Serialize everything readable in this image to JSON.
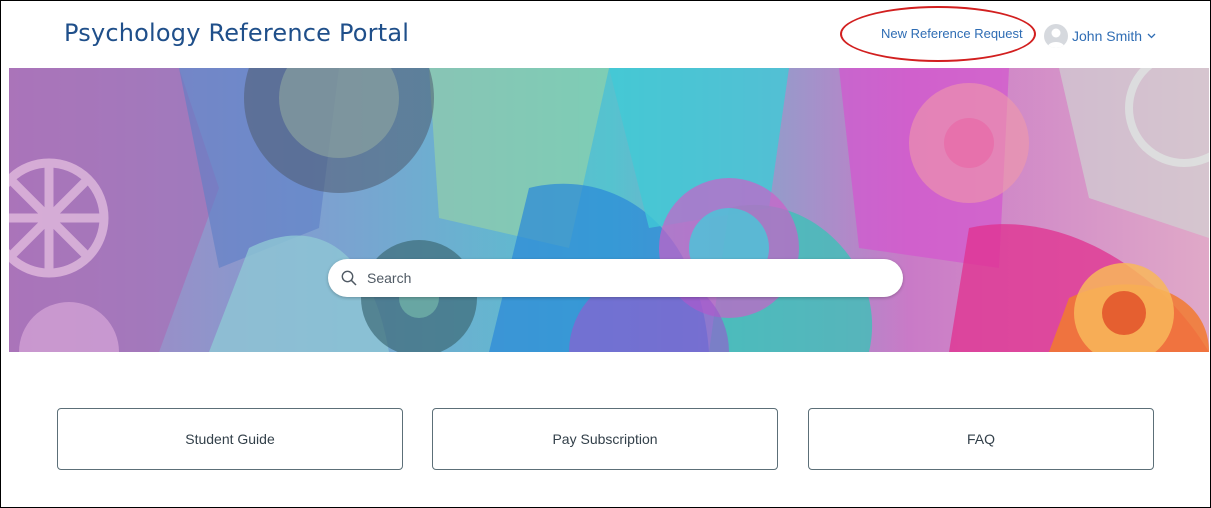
{
  "header": {
    "title": "Psychology Reference Portal",
    "nav_link": "New Reference Request",
    "user_name": "John Smith"
  },
  "search": {
    "placeholder": "Search"
  },
  "tiles": [
    {
      "label": "Student Guide"
    },
    {
      "label": "Pay Subscription"
    },
    {
      "label": "FAQ"
    }
  ],
  "colors": {
    "title": "#1f4f8a",
    "link": "#2f6db4",
    "highlight": "#d21f1f",
    "tile_border": "#5c6f78"
  },
  "icons": {
    "search": "search-icon",
    "avatar": "user-avatar-icon",
    "chevron": "chevron-down-icon"
  }
}
